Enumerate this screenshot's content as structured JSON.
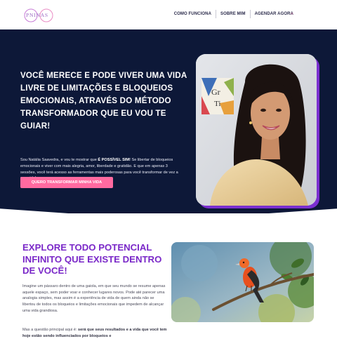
{
  "header": {
    "logo_text": "PNINAS",
    "nav": [
      "COMO FUNCIONA",
      "SOBRE MIM",
      "AGENDAR AGORA"
    ],
    "nav_extra": "○"
  },
  "hero": {
    "title": "VOCÊ MERECE E PODE VIVER UMA VIDA LIVRE DE LIMITAÇÕES E BLOQUEIOS EMOCIONAIS, ATRAVÉS DO MÉTODO TRANSFORMADOR QUE EU VOU TE GUIAR!",
    "text_before": "Sou Natália Saavedra, e vou te mostrar que ",
    "text_bold": "É POSSÍVEL SIM!",
    "text_after": " Se libertar de bloqueios emocionais e viver com mais alegria, amor, liberdade e gratidão. E que em apenas 3 sessões, você terá acesso as ferramentas mais poderosas para você transformar de vez a sua vida!",
    "cta_label": "QUERO TRANSFORMAR MINHA VIDA",
    "colors": {
      "background": "#0d1838",
      "cta": "#ff6aa0",
      "photo_shadow": "#7b2fd0"
    }
  },
  "explore": {
    "title": "EXPLORE TODO POTENCIAL INFINITO QUE EXISTE DENTRO DE VOCÊ!",
    "paragraph1": "Imagine um pássaro dentro de uma gaiola, em que seu mundo se resume apenas aquele espaço, sem poder voar e conhecer lugares novos. Pode até parecer uma analogia simples, mas assim é a experiência de vida de quem ainda não se libertou de todos os bloqueios e limitações emocionais que impedem de alcançar uma vida grandiosa.",
    "paragraph2_before": "Mas a questão principal aqui é: ",
    "paragraph2_bold": "será que seus resultados e a vida que você tem hoje estão sendo influenciados por bloqueios e",
    "title_color": "#7a28c8"
  }
}
